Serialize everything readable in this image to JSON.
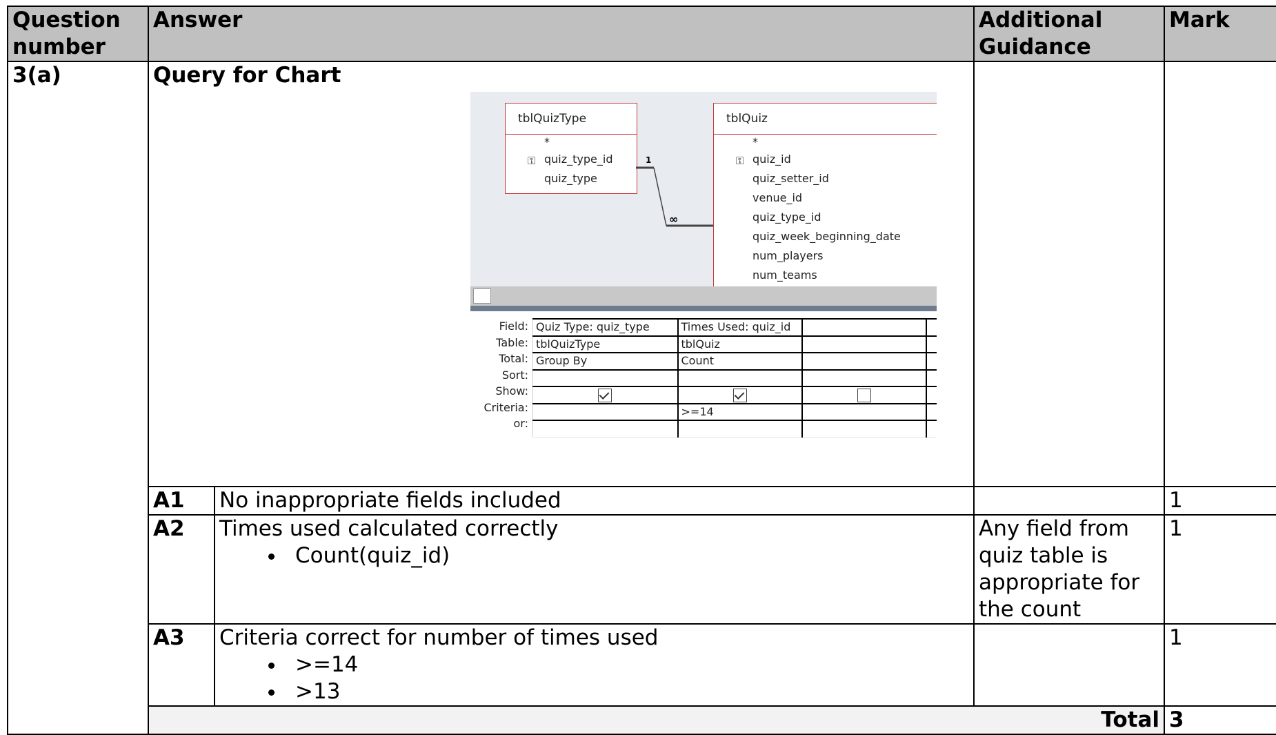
{
  "headers": {
    "question_number": "Question number",
    "answer": "Answer",
    "additional_guidance": "Additional Guidance",
    "mark": "Mark"
  },
  "question": {
    "number": "3(a)",
    "heading": "Query for Chart"
  },
  "query_design": {
    "tables": [
      {
        "name": "tblQuizType",
        "star": "*",
        "fields": [
          "quiz_type_id",
          "quiz_type"
        ],
        "key_field": "quiz_type_id"
      },
      {
        "name": "tblQuiz",
        "star": "*",
        "fields": [
          "quiz_id",
          "quiz_setter_id",
          "venue_id",
          "quiz_type_id",
          "quiz_week_beginning_date",
          "num_players",
          "num_teams"
        ],
        "key_field": "quiz_id"
      }
    ],
    "relationship": {
      "one_label": "1",
      "many_label": "∞"
    },
    "grid_labels": [
      "Field:",
      "Table:",
      "Total:",
      "Sort:",
      "Show:",
      "Criteria:",
      "or:"
    ],
    "columns": [
      {
        "field": "Quiz Type: quiz_type",
        "table": "tblQuizType",
        "total": "Group By",
        "sort": "",
        "show": true,
        "criteria": "",
        "or": ""
      },
      {
        "field": "Times Used: quiz_id",
        "table": "tblQuiz",
        "total": "Count",
        "sort": "",
        "show": true,
        "criteria": ">=14",
        "or": ""
      },
      {
        "field": "",
        "table": "",
        "total": "",
        "sort": "",
        "show": false,
        "criteria": "",
        "or": ""
      }
    ]
  },
  "marks": [
    {
      "code": "A1",
      "text": "No inappropriate fields included",
      "points": [],
      "guidance": "",
      "mark": "1"
    },
    {
      "code": "A2",
      "text": "Times used calculated correctly",
      "points": [
        "Count(quiz_id)"
      ],
      "guidance": "Any field from quiz table is appropriate for the count",
      "mark": "1"
    },
    {
      "code": "A3",
      "text": "Criteria correct for number of times used",
      "points": [
        ">=14",
        ">13"
      ],
      "guidance": "",
      "mark": "1"
    }
  ],
  "total": {
    "label": "Total",
    "value": "3"
  }
}
